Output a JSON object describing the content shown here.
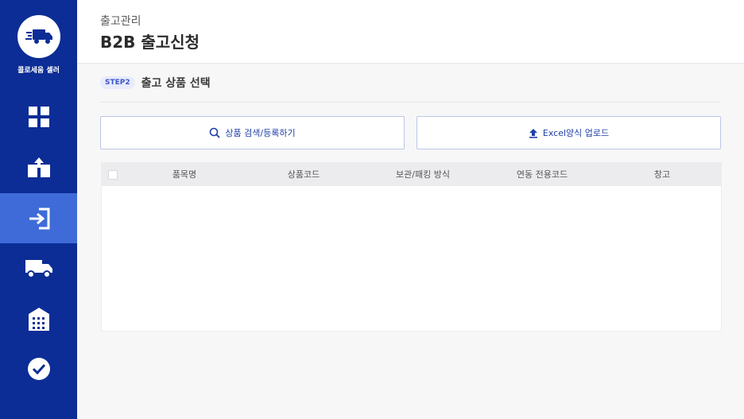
{
  "brand": {
    "name": "콜로세움 셀러",
    "logo_icon": "delivery-truck-logo-icon"
  },
  "sidebar": {
    "items": [
      {
        "icon": "dashboard-grid-icon",
        "active": false
      },
      {
        "icon": "inbound-box-icon",
        "active": false
      },
      {
        "icon": "outbound-arrow-icon",
        "active": true
      },
      {
        "icon": "truck-icon",
        "active": false
      },
      {
        "icon": "warehouse-icon",
        "active": false
      },
      {
        "icon": "check-circle-icon",
        "active": false
      }
    ],
    "colors": {
      "background": "#0c2d96",
      "active": "#3f6bd8"
    }
  },
  "header": {
    "breadcrumb": "출고관리",
    "title": "B2B 출고신청"
  },
  "step": {
    "badge": "STEP2",
    "title": "출고 상품 선택"
  },
  "actions": {
    "search_label": "상품 검색/등록하기",
    "upload_label": "Excel양식 업로드"
  },
  "table": {
    "columns": [
      "품목명",
      "상품코드",
      "보관/패킹 방식",
      "연동 전용코드",
      "창고"
    ],
    "rows": []
  }
}
